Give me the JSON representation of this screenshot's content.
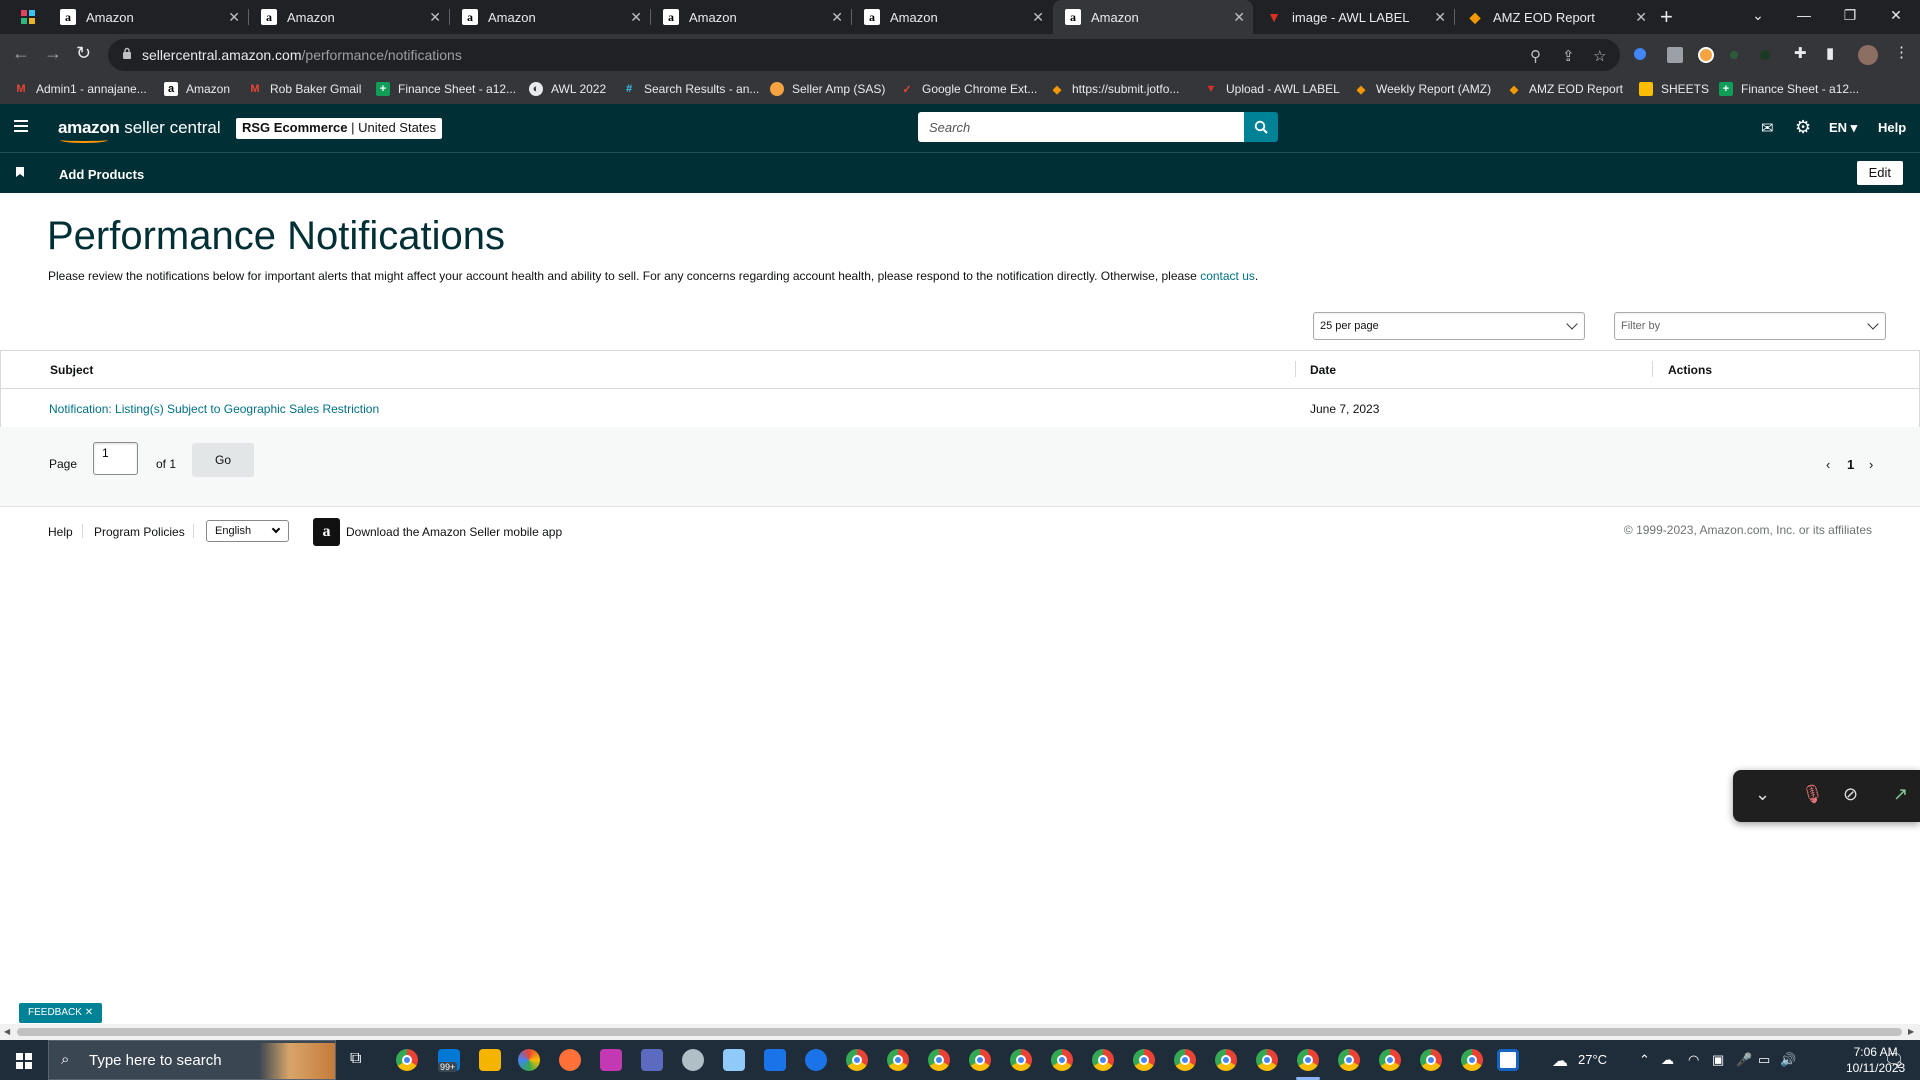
{
  "browser": {
    "tabs": [
      {
        "title": "Amazon",
        "icon": "amazon-icon"
      },
      {
        "title": "Amazon",
        "icon": "amazon-icon"
      },
      {
        "title": "Amazon",
        "icon": "amazon-icon"
      },
      {
        "title": "Amazon",
        "icon": "amazon-icon"
      },
      {
        "title": "Amazon",
        "icon": "amazon-icon"
      },
      {
        "title": "Amazon",
        "icon": "amazon-icon",
        "active": true
      },
      {
        "title": "image - AWL LABEL",
        "icon": "awl-icon"
      },
      {
        "title": "AMZ EOD Report",
        "icon": "eod-icon"
      }
    ],
    "url_host": "sellercentral.amazon.com",
    "url_path": "/performance/notifications",
    "bookmarks": [
      "Admin1 - annajane...",
      "Amazon",
      "Rob Baker Gmail",
      "Finance Sheet - a12...",
      "AWL 2022",
      "Search Results - an...",
      "Seller Amp (SAS)",
      "Google Chrome Ext...",
      "https://submit.jotfo...",
      "Upload - AWL LABEL",
      "Weekly Report (AMZ)",
      "AMZ EOD Report",
      "SHEETS",
      "Finance Sheet - a12..."
    ]
  },
  "header": {
    "logo_bold": "amazon",
    "logo_rest": " seller central",
    "store": "RSG Ecommerce",
    "marketplace": "United States",
    "search_placeholder": "Search",
    "language": "EN",
    "help": "Help"
  },
  "subnav": {
    "link": "Add Products",
    "edit": "Edit"
  },
  "page": {
    "title": "Performance Notifications",
    "description": "Please review the notifications below for important alerts that might affect your account health and ability to sell. For any concerns regarding account health, please respond to the notification directly. Otherwise, please ",
    "contact_link": "contact us",
    "per_page": "25 per page",
    "filter_placeholder": "Filter by"
  },
  "table": {
    "headers": {
      "subject": "Subject",
      "date": "Date",
      "actions": "Actions"
    },
    "rows": [
      {
        "subject": "Notification: Listing(s) Subject to Geographic Sales Restriction",
        "date": "June 7, 2023"
      }
    ]
  },
  "pagination": {
    "page_label": "Page",
    "current": "1",
    "of_label": "of 1",
    "go": "Go",
    "page_number": "1"
  },
  "footer": {
    "help": "Help",
    "policies": "Program Policies",
    "language": "English",
    "app_download": "Download the Amazon Seller mobile app",
    "copyright": "© 1999-2023, Amazon.com, Inc. or its affiliates"
  },
  "feedback": "FEEDBACK",
  "taskbar": {
    "search_placeholder": "Type here to search",
    "mail_badge": "99+",
    "weather": "27°C",
    "time": "7:06 AM",
    "date": "10/11/2023",
    "notifications": "2"
  },
  "colors": {
    "header_bg": "#002f36",
    "link": "#007185",
    "accent": "#008296"
  }
}
